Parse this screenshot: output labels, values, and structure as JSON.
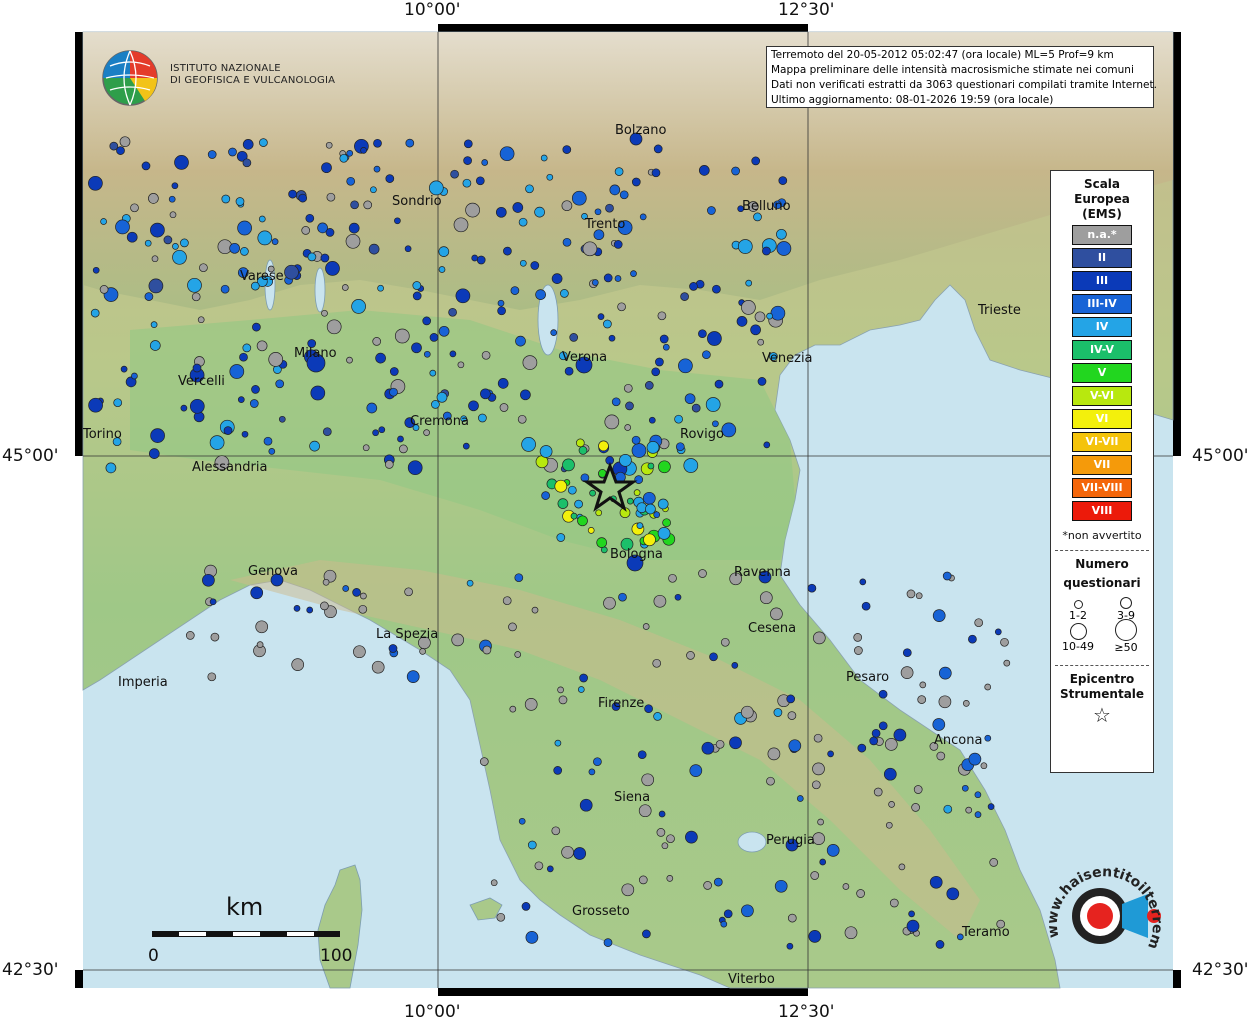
{
  "coords": {
    "top_left": "10°00'",
    "top_right": "12°30'",
    "bottom_left": "10°00'",
    "bottom_right": "12°30'",
    "lat_left_top": "45°00'",
    "lat_right_top": "45°00'",
    "lat_left_bottom": "42°30'",
    "lat_right_bottom": "42°30'"
  },
  "logo": {
    "line1": "ISTITUTO NAZIONALE",
    "line2": "DI GEOFISICA E VULCANOLOGIA"
  },
  "info": {
    "line1": "Terremoto del 20-05-2012 05:02:47 (ora locale) ML=5 Prof=9 km",
    "line2": "Mappa preliminare delle intensità macrosismiche stimate nei comuni",
    "line3": "Dati non verificati estratti da 3063 questionari compilati tramite Internet.",
    "line4": "Ultimo aggiornamento: 08-01-2026 19:59 (ora locale)"
  },
  "legend": {
    "title1": "Scala",
    "title2": "Europea",
    "title3": "(EMS)",
    "classes": [
      {
        "label": "n.a.*",
        "color": "#9e9e9e"
      },
      {
        "label": "II",
        "color": "#2f4f9f"
      },
      {
        "label": "III",
        "color": "#0b3ab8"
      },
      {
        "label": "III-IV",
        "color": "#1763d6"
      },
      {
        "label": "IV",
        "color": "#24a4e6"
      },
      {
        "label": "IV-V",
        "color": "#1bbf6a"
      },
      {
        "label": "V",
        "color": "#22d61f"
      },
      {
        "label": "V-VI",
        "color": "#b8e80e"
      },
      {
        "label": "VI",
        "color": "#f3f00c"
      },
      {
        "label": "VI-VII",
        "color": "#f4c30b"
      },
      {
        "label": "VII",
        "color": "#f59a0a"
      },
      {
        "label": "VII-VIII",
        "color": "#f4660a"
      },
      {
        "label": "VIII",
        "color": "#ec1a0a"
      }
    ],
    "na_note": "*non avvertito",
    "count_title1": "Numero",
    "count_title2": "questionari",
    "sizes": {
      "s1": "1-2",
      "s2": "3-9",
      "s3": "10-49",
      "s4": "≥50"
    },
    "epi_title1": "Epicentro",
    "epi_title2": "Strumentale",
    "epi_symbol": "☆"
  },
  "scale": {
    "unit": "km",
    "left": "0",
    "right": "100"
  },
  "cities": [
    {
      "name": "Bolzano"
    },
    {
      "name": "Sondrio"
    },
    {
      "name": "Trento"
    },
    {
      "name": "Belluno"
    },
    {
      "name": "Varese"
    },
    {
      "name": "Trieste"
    },
    {
      "name": "Milano"
    },
    {
      "name": "Verona"
    },
    {
      "name": "Venezia"
    },
    {
      "name": "Vercelli"
    },
    {
      "name": "Cremona"
    },
    {
      "name": "Rovigo"
    },
    {
      "name": "Torino"
    },
    {
      "name": "Alessandria"
    },
    {
      "name": "Bologna"
    },
    {
      "name": "Genova"
    },
    {
      "name": "Ravenna"
    },
    {
      "name": "La Spezia"
    },
    {
      "name": "Cesena"
    },
    {
      "name": "Imperia"
    },
    {
      "name": "Pesaro"
    },
    {
      "name": "Firenze"
    },
    {
      "name": "Ancona"
    },
    {
      "name": "Siena"
    },
    {
      "name": "Perugia"
    },
    {
      "name": "Grosseto"
    },
    {
      "name": "Teramo"
    },
    {
      "name": "Viterbo"
    }
  ],
  "badge": {
    "text": "www.haisentitoilterremoto.it"
  }
}
